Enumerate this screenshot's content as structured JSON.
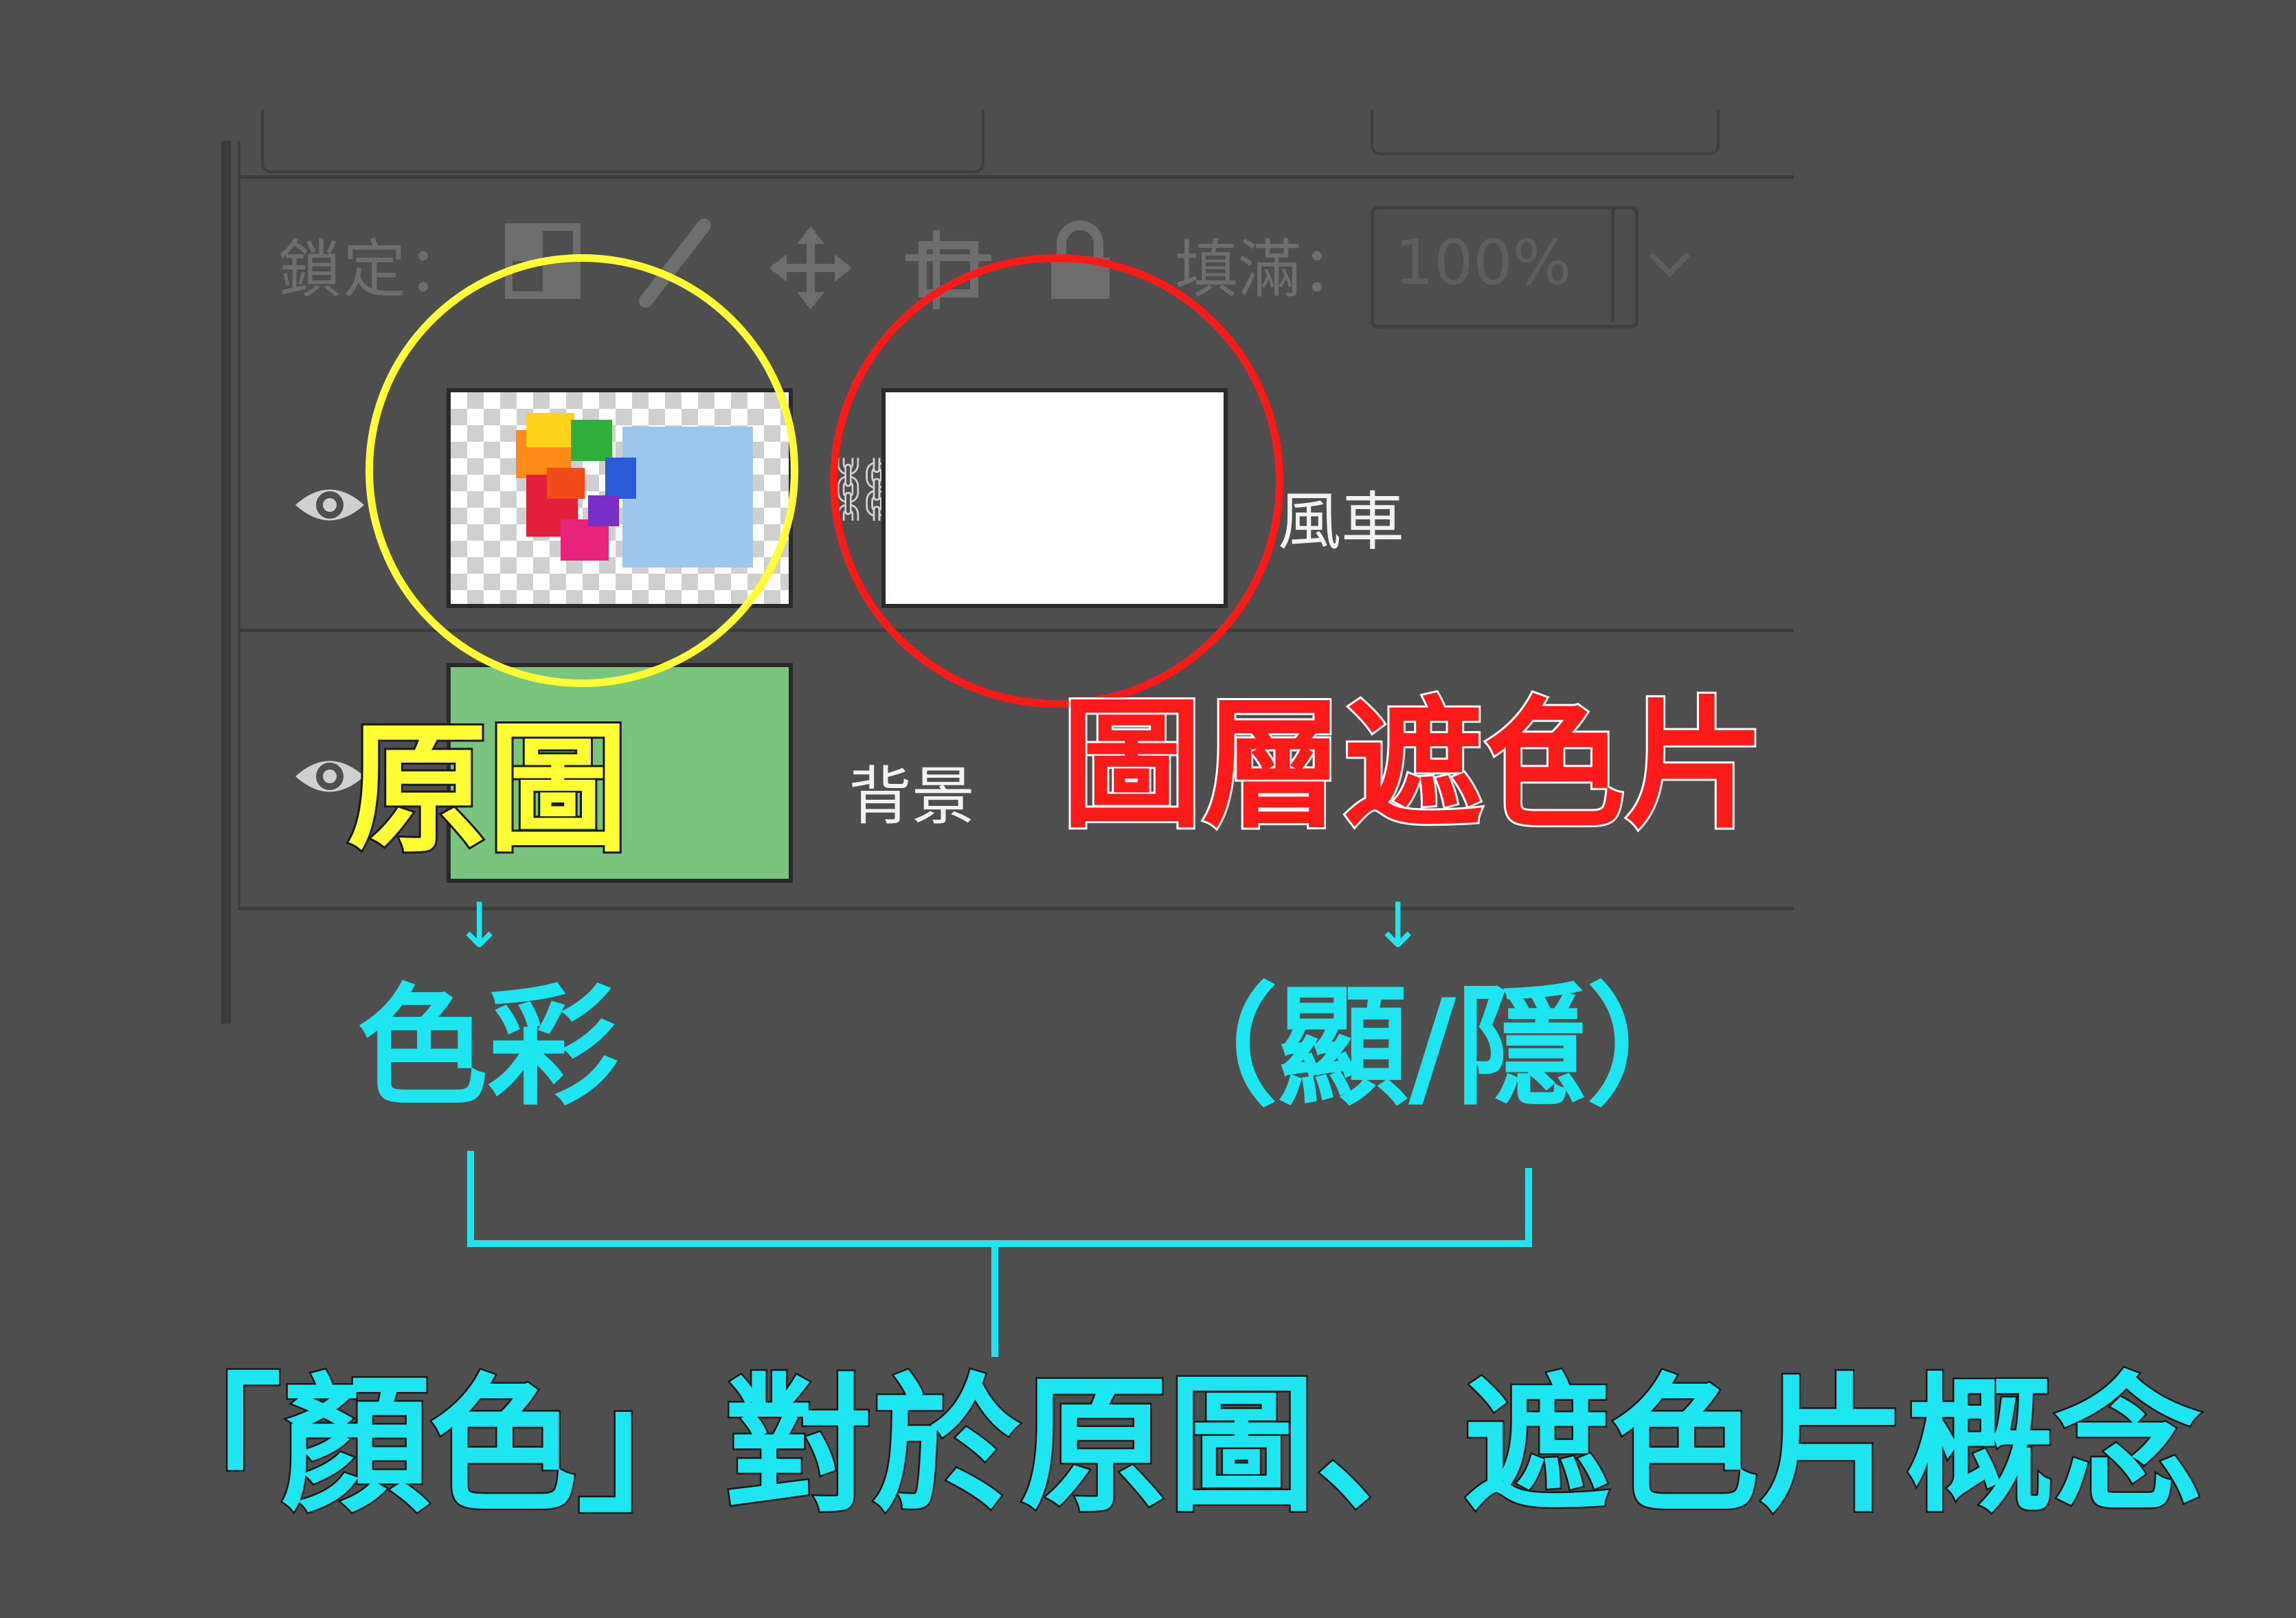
{
  "panel": {
    "lock_label": "鎖定：",
    "fill_label": "填滿：",
    "fill_value": "100%",
    "icons": [
      "lock-transparent-icon",
      "brush-icon",
      "move-icon",
      "artboard-icon",
      "lock-icon",
      "chevron-down-icon",
      "eye-icon",
      "chain-link-icon"
    ],
    "layers": [
      {
        "name": "風車",
        "visible": true
      },
      {
        "name": "背景",
        "visible": true
      }
    ]
  },
  "annotations": {
    "original_label": "原圖",
    "mask_label": "圖層遮色片",
    "original_role": "色彩",
    "mask_role": "（顯/隱）",
    "arrow": "↓",
    "summary": "「顏色」對於原圖、遮色片概念"
  },
  "colors": {
    "background": "#4e4e4e",
    "yellow": "#ffff33",
    "red": "#ff1a1a",
    "cyan": "#1ee6f0",
    "bg_layer_thumb": "#79c57f"
  }
}
